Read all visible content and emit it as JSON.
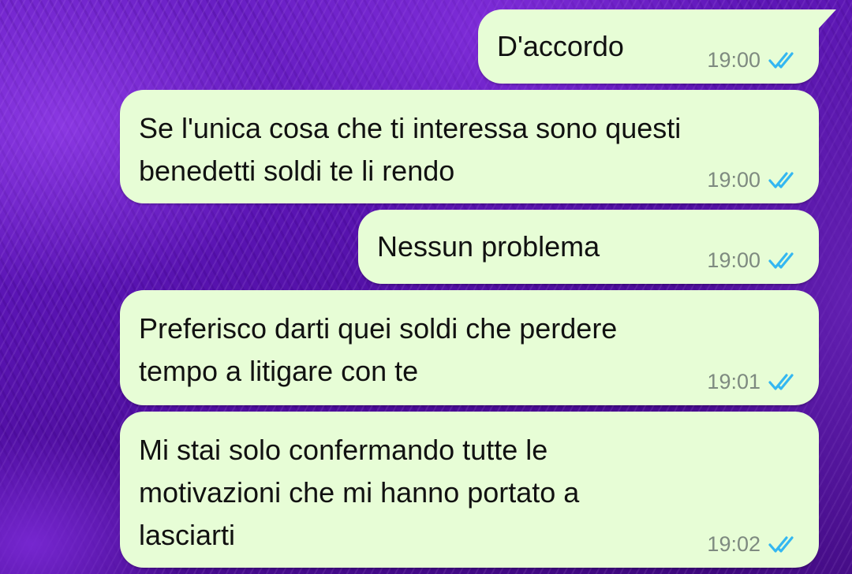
{
  "messages": [
    {
      "text": "D'accordo",
      "time": "19:00",
      "status": "read-double-check-icon"
    },
    {
      "text": "Se l'unica cosa che ti interessa sono questi\nbenedetti soldi te li rendo",
      "time": "19:00",
      "status": "read-double-check-icon"
    },
    {
      "text": "Nessun problema",
      "time": "19:00",
      "status": "read-double-check-icon"
    },
    {
      "text": "Preferisco darti quei soldi che perdere\ntempo a litigare con te",
      "time": "19:01",
      "status": "read-double-check-icon"
    },
    {
      "text": "Mi stai solo confermando tutte le\nmotivazioni che mi hanno portato a\nlasciarti",
      "time": "19:02",
      "status": "read-double-check-icon"
    }
  ],
  "colors": {
    "bubble": "#e7fdd6",
    "text": "#111111",
    "time": "#7e8a80",
    "read_check": "#34b7f1",
    "wallpaper": "#5a14b3"
  }
}
